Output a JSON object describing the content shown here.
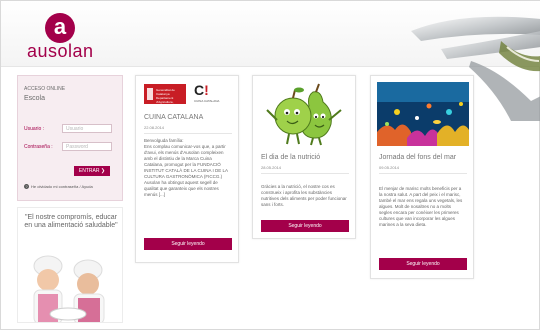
{
  "header": {
    "logo_letter": "a",
    "logo_text": "ausolan"
  },
  "login": {
    "title_small": "ACCESO ONLINE",
    "title": "Escola",
    "user_label": "Usuario :",
    "user_placeholder": "Usuario",
    "password_label": "Contraseña :",
    "password_placeholder": "Password",
    "submit_label": "ENTRAR ❯",
    "forgot_icon": "?",
    "forgot_text": "He olvidado mi contraseña / Ayuda"
  },
  "quote": {
    "text": "\"El nostre compromís, educar en una alimentació saludable\""
  },
  "cards": [
    {
      "logo_red_text": "Generalitat de Catalunya Departament d'Agricultura, Ramaderia, Pesca",
      "logo_ci": "C",
      "logo_ci_excl": "!",
      "logo_ci_sub": "CUINA CATALANA",
      "title": "CUINA CATALANA",
      "date": "22.08.2014",
      "body": "Benvolguda família:\nEns complau comunicar-vos que, a partir d'avui, els menús d'Ausolan compleixen amb el distintiu de la Marca Cuina Catalana, promogut per la FUNDACIÓ INSTITUT CATALÀ DE LA CUINA I DE LA CULTURA GASTRONÒMICA (FICCG.)\nAusolan ha obtingut aquest segell de qualitat que garanteix que els nostres menús [...]",
      "button": "Seguir leyendo"
    },
    {
      "title": "El dia de la nutrició",
      "date": "28.05.2014",
      "body": "Gràcies a la nutrició, el nostre cos es construeix i aprofita les substàncies nutritives dels aliments per poder funcionar sans i forts.",
      "button": "Seguir leyendo"
    },
    {
      "title": "Jornada del fons del mar",
      "date": "09.05.2014",
      "body": "El menjar de marisc molts beneficis per a la nostra salut. A part del peix i el marisc, també el mar ens regala uns vegetals, les algues. Molt de nosaltres no a molts segles encara per conèixer les primeres cultures que van incorporar les algues marines a la seva dieta.",
      "button": "Seguir leyendo"
    }
  ],
  "colors": {
    "brand": "#a3004a",
    "panel_bg": "#f7edf1"
  },
  "icons": {
    "question": "question-circle-icon"
  }
}
